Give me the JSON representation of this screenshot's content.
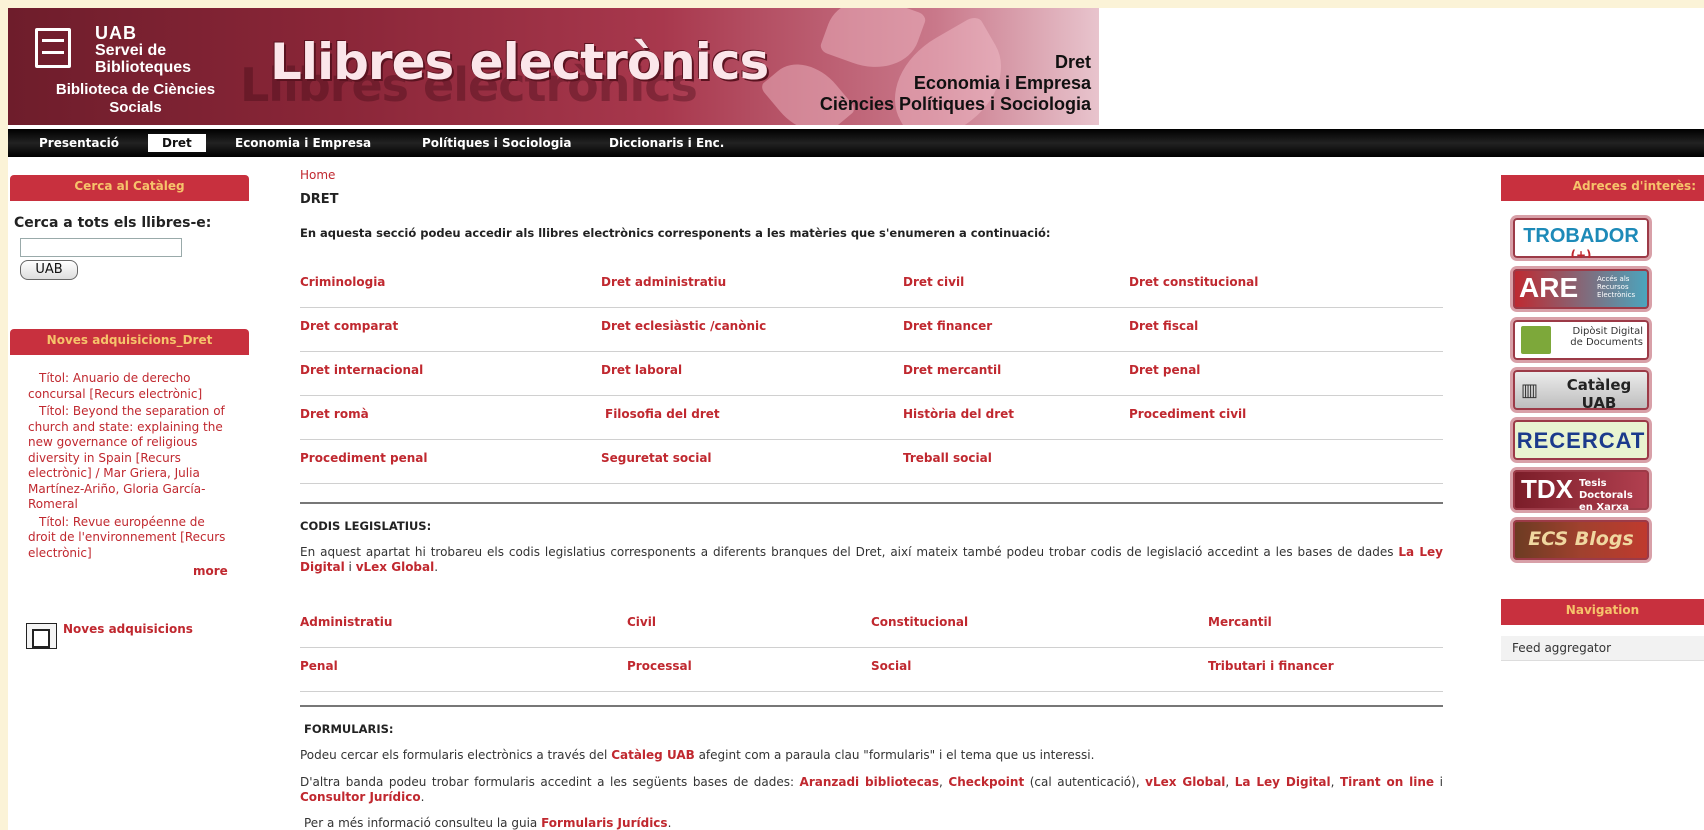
{
  "banner": {
    "org_line1": "UAB",
    "org_line2": "Servei de",
    "org_line3": "Biblioteques",
    "library_line1": "Biblioteca de Ciències",
    "library_line2": "Socials",
    "title": "Llibres electrònics",
    "subjects": [
      "Dret",
      "Economia i Empresa",
      "Ciències Polítiques i Sociologia"
    ]
  },
  "nav": {
    "items": [
      "Presentació",
      "Dret",
      "Economia i Empresa",
      "Polítiques i Sociologia",
      "Diccionaris i Enc."
    ],
    "active": "Dret"
  },
  "left_sidebar": {
    "catalog_block": {
      "title": "Cerca al Catàleg",
      "search_label": "Cerca a tots els llibres-e:",
      "search_value": "",
      "button_label": "UAB"
    },
    "acquisitions_block": {
      "title": "Noves adquisicions_Dret",
      "items": [
        "Títol: Anuario de derecho concursal [Recurs electrònic]",
        "Títol: Beyond the separation of church and state: explaining the new governance of religious diversity in Spain [Recurs electrònic] / Mar Griera, Julia Martínez-Ariño, Gloria García-Romeral",
        "Títol: Revue européenne de droit de l'environnement [Recurs electrònic]"
      ],
      "more_label": "more",
      "feed_label": "Noves adquisicions"
    }
  },
  "main": {
    "breadcrumb": "Home",
    "title": "DRET",
    "intro": "En aquesta secció podeu accedir als llibres electrònics corresponents a les matèries que s'enumeren a continuació:",
    "subjects": [
      [
        "Criminologia",
        "Dret administratiu",
        "Dret civil",
        "Dret constitucional"
      ],
      [
        "Dret comparat",
        "Dret eclesiàstic /canònic",
        "Dret financer",
        "Dret fiscal"
      ],
      [
        "Dret internacional",
        "Dret laboral",
        "Dret mercantil",
        "Dret penal"
      ],
      [
        "Dret romà",
        "Filosofia del dret",
        "Història del dret",
        "Procediment civil"
      ],
      [
        "Procediment penal",
        "Seguretat social",
        "Treball social",
        ""
      ]
    ],
    "codes": {
      "title": "CODIS LEGISLATIUS:",
      "text_before": "En aquest apartat hi trobareu els codis legislatius corresponents a diferents branques del Dret, així mateix també podeu trobar codis de legislació accedint a les bases de dades ",
      "link1": "La Ley Digital",
      "text_mid": " i ",
      "link2": "vLex Global",
      "text_after": ".",
      "items": [
        [
          "Administratiu",
          "Civil",
          "Constitucional",
          "Mercantil"
        ],
        [
          "Penal",
          "Processal",
          "Social",
          "Tributari i financer"
        ]
      ]
    },
    "forms": {
      "title": "FORMULARIS:",
      "p1_before": "Podeu cercar els formularis electrònics a través del ",
      "p1_link": "Catàleg UAB",
      "p1_after": " afegint com a paraula clau \"formularis\" i el tema que us interessi.",
      "p2_before": "D'altra banda podeu trobar formularis accedint a les següents bases de dades: ",
      "p2_links": [
        "Aranzadi bibliotecas",
        "Checkpoint",
        "vLex Global",
        "La Ley Digital",
        "Tirant on line",
        "Consultor Jurídico"
      ],
      "p2_note": " (cal autenticació), ",
      "p3_before": "Per a més informació consulteu la guia ",
      "p3_link": "Formularis Jurídics",
      "p3_after": "."
    }
  },
  "right_sidebar": {
    "resources_title": "Adreces d'interès:",
    "resources": [
      {
        "label": "TROBADOR",
        "suffix": "(+)",
        "color": "#c0282f",
        "bg": "#ffffff"
      },
      {
        "label": "ARE",
        "suffix": "Accés als Recursos Electrònics",
        "color": "#ffffff",
        "bg": "#c0282f"
      },
      {
        "label": "Dipòsit Digital de Documents",
        "color": "#333333",
        "bg": "#ffffff"
      },
      {
        "label": "Catàleg UAB",
        "color": "#333333",
        "bg": "#d8d8d8"
      },
      {
        "label": "RECERCAT",
        "color": "#1b3a8c",
        "bg": "#e9f4d0"
      },
      {
        "label": "TDX",
        "suffix": "Tesis Doctorals en Xarxa",
        "color": "#ffffff",
        "bg": "#9c2431"
      },
      {
        "label": "ECS Blogs",
        "color": "#f0d7a0",
        "bg": "#8a3a2a"
      }
    ],
    "navigation_title": "Navigation",
    "navigation_items": [
      "Feed aggregator"
    ]
  }
}
